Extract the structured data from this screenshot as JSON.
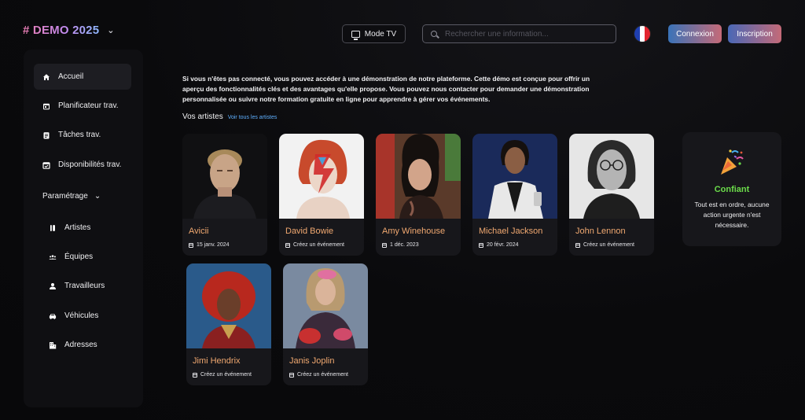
{
  "brand": {
    "name": "# DEMO 2025"
  },
  "header": {
    "tv_mode_label": "Mode TV",
    "search_placeholder": "Rechercher une information...",
    "login_label": "Connexion",
    "signup_label": "Inscription",
    "flag_colors": [
      "#1f3fb0",
      "#ffffff",
      "#e2242f"
    ]
  },
  "sidebar": {
    "items": [
      {
        "label": "Accueil",
        "icon": "home-icon",
        "active": true
      },
      {
        "label": "Planificateur trav.",
        "icon": "calendar-icon"
      },
      {
        "label": "Tâches trav.",
        "icon": "clipboard-icon"
      },
      {
        "label": "Disponibilités trav.",
        "icon": "calendar-check-icon"
      }
    ],
    "settings_label": "Paramétrage",
    "sub_items": [
      {
        "label": "Artistes",
        "icon": "guitar-icon"
      },
      {
        "label": "Équipes",
        "icon": "group-icon"
      },
      {
        "label": "Travailleurs",
        "icon": "person-icon"
      },
      {
        "label": "Véhicules",
        "icon": "car-icon"
      },
      {
        "label": "Adresses",
        "icon": "building-icon"
      }
    ]
  },
  "main": {
    "intro": "Si vous n'êtes pas connecté, vous pouvez accéder à une démonstration de notre plateforme. Cette démo est conçue pour offrir un aperçu des fonctionnalités clés et des avantages qu'elle propose. Vous pouvez nous contacter pour demander une démonstration personnalisée ou suivre notre formation gratuite en ligne pour apprendre à gérer vos événements.",
    "artists_title": "Vos artistes",
    "see_all_label": "Voir tous les artistes",
    "artists": [
      {
        "name": "Avicii",
        "date": "15 janv. 2024"
      },
      {
        "name": "David Bowie",
        "date": "Créez un événement"
      },
      {
        "name": "Amy Winehouse",
        "date": "1 déc. 2023"
      },
      {
        "name": "Michael Jackson",
        "date": "20 févr. 2024"
      },
      {
        "name": "John Lennon",
        "date": "Créez un événement"
      },
      {
        "name": "Jimi Hendrix",
        "date": "Créez un événement"
      },
      {
        "name": "Janis Joplin",
        "date": "Créez un événement"
      }
    ],
    "status": {
      "title": "Confiant",
      "text": "Tout est en ordre, aucune action urgente n'est nécessaire."
    }
  },
  "colors": {
    "accent_orange": "#f0a870",
    "status_green": "#6bdc4a",
    "link_blue": "#5fb0ff"
  }
}
